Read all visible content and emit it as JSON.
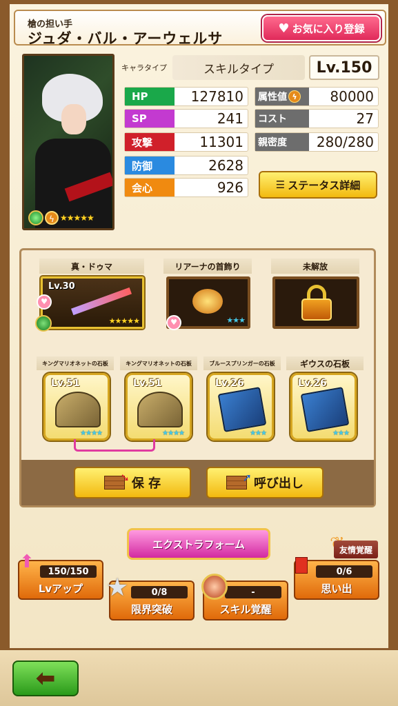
{
  "header": {
    "subtitle": "槍の担い手",
    "name": "ジュダ・バル・アーウェルサ",
    "favorite_label": "お気に入り登録"
  },
  "portrait": {
    "stars": "★★★★★"
  },
  "type": {
    "chara_type_label": "キャラタイプ",
    "skill_type": "スキルタイプ",
    "level": "Lv.150"
  },
  "stats": {
    "hp": {
      "label": "HP",
      "value": "127810",
      "color": "#1aa84a"
    },
    "sp": {
      "label": "SP",
      "value": "241",
      "color": "#c33ad0"
    },
    "atk": {
      "label": "攻撃",
      "value": "11301",
      "color": "#d0202a"
    },
    "def": {
      "label": "防御",
      "value": "2628",
      "color": "#2a8ae0"
    },
    "crit": {
      "label": "会心",
      "value": "926",
      "color": "#f08a10"
    },
    "attr": {
      "label": "属性値",
      "value": "80000"
    },
    "cost": {
      "label": "コスト",
      "value": "27"
    },
    "intimacy": {
      "label": "親密度",
      "value": "280/280"
    }
  },
  "status_detail_label": "ステータス詳細",
  "equipment": {
    "weapon": {
      "title": "真・ドゥマ",
      "level": "Lv.30",
      "stars": "★★★★★"
    },
    "accessory": {
      "title": "リアーナの首飾り",
      "stars": "★★★"
    },
    "locked": {
      "title": "未解放"
    }
  },
  "tablets": [
    {
      "title": "キングマリオネットの石板",
      "level": "Lv.51",
      "stars": "★★★★"
    },
    {
      "title": "キングマリオネットの石板",
      "level": "Lv.51",
      "stars": "★★★★"
    },
    {
      "title": "ブルースプリンガーの石板",
      "level": "Lv.26",
      "stars": "★★★"
    },
    {
      "title": "ギウスの石板",
      "level": "Lv.26",
      "stars": "★★★"
    }
  ],
  "actions": {
    "save": "保 存",
    "load": "呼び出し",
    "extra_form": "エクストラフォーム"
  },
  "bottom": {
    "lv_up": {
      "label": "Lvアップ",
      "progress": "150/150"
    },
    "limit_break": {
      "label": "限界突破",
      "progress": "0/8"
    },
    "skill_awaken": {
      "label": "スキル覚醒",
      "progress": "-"
    },
    "memories": {
      "label": "思い出",
      "progress": "0/6",
      "tag": "友情覚醒"
    }
  }
}
